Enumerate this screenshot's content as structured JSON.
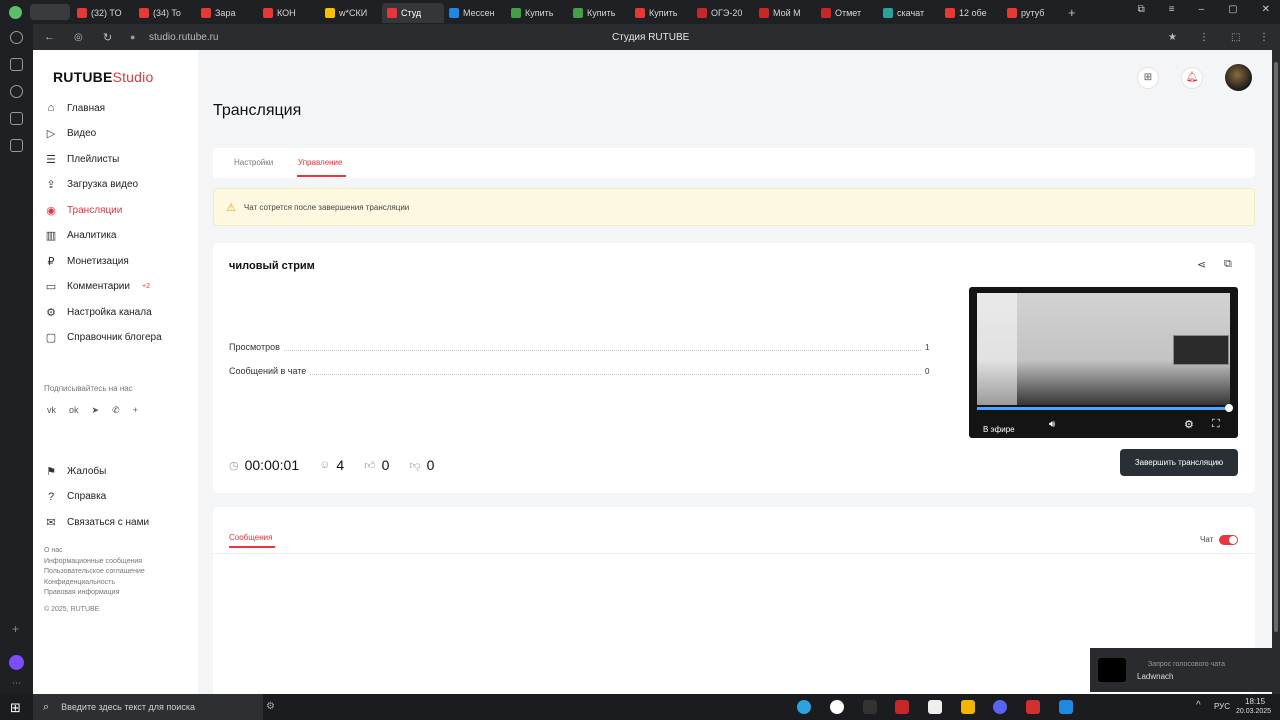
{
  "browser": {
    "tabs": [
      {
        "label": "(32) TO",
        "color": "#e53935",
        "active": false
      },
      {
        "label": "(34) To",
        "color": "#e53935",
        "active": false
      },
      {
        "label": "Зара",
        "color": "#e53935",
        "active": false
      },
      {
        "label": "КОН",
        "color": "#e53935",
        "active": false
      },
      {
        "label": "w*СКИ",
        "color": "#f6c000",
        "active": false
      },
      {
        "label": "Студ",
        "color": "#e8353f",
        "active": true
      },
      {
        "label": "Мессен",
        "color": "#1e88e5",
        "active": false
      },
      {
        "label": "Купить",
        "color": "#43a047",
        "active": false
      },
      {
        "label": "Купить",
        "color": "#43a047",
        "active": false
      },
      {
        "label": "Купить",
        "color": "#e53935",
        "active": false
      },
      {
        "label": "ОГЭ-20",
        "color": "#c62828",
        "active": false
      },
      {
        "label": "Мой М",
        "color": "#c62828",
        "active": false
      },
      {
        "label": "Отмет",
        "color": "#c62828",
        "active": false
      },
      {
        "label": "скачат",
        "color": "#26a69a",
        "active": false
      },
      {
        "label": "12 обе",
        "color": "#e53935",
        "active": false
      },
      {
        "label": "рутуб",
        "color": "#e53935",
        "active": false
      }
    ],
    "url": "studio.rutube.ru",
    "page_title": "Студия RUTUBE"
  },
  "sidebar": {
    "logo_main": "RUTUBE",
    "logo_sub": "Studio",
    "items": [
      {
        "label": "Главная",
        "icon": "home-icon",
        "glyph": "⌂"
      },
      {
        "label": "Видео",
        "icon": "video-icon",
        "glyph": "▷"
      },
      {
        "label": "Плейлисты",
        "icon": "playlist-icon",
        "glyph": "☰"
      },
      {
        "label": "Загрузка видео",
        "icon": "upload-icon",
        "glyph": "⇪"
      },
      {
        "label": "Трансляции",
        "icon": "broadcast-icon",
        "glyph": "◉",
        "active": true
      },
      {
        "label": "Аналитика",
        "icon": "analytics-icon",
        "glyph": "▥"
      },
      {
        "label": "Монетизация",
        "icon": "monetization-icon",
        "glyph": "₽"
      },
      {
        "label": "Комментарии",
        "icon": "comments-icon",
        "glyph": "▭",
        "badge": "+2"
      },
      {
        "label": "Настройка канала",
        "icon": "settings-icon",
        "glyph": "⚙"
      },
      {
        "label": "Справочник блогера",
        "icon": "guide-icon",
        "glyph": "▢"
      }
    ],
    "follow_label": "Подписывайтесь на нас",
    "socials": [
      "vk",
      "ok",
      "tg",
      "viber",
      "+"
    ],
    "bottom_items": [
      {
        "label": "Жалобы",
        "icon": "flag-icon",
        "glyph": "⚑"
      },
      {
        "label": "Справка",
        "icon": "help-icon",
        "glyph": "?"
      },
      {
        "label": "Связаться с нами",
        "icon": "mail-icon",
        "glyph": "✉"
      }
    ],
    "footer_links": [
      "О нас",
      "Информационные сообщения",
      "Пользовательское соглашение",
      "Конфиденциальность",
      "Правовая информация",
      "© 2025, RUTUBE"
    ]
  },
  "main": {
    "title": "Трансляция",
    "tabs": [
      {
        "label": "Настройки",
        "active": false
      },
      {
        "label": "Управление",
        "active": true
      }
    ],
    "warning": "Чат сотрется после завершения трансляции",
    "stream": {
      "name": "чиловый стрим",
      "stats": [
        {
          "label": "Просмотров",
          "value": "1"
        },
        {
          "label": "Сообщений в чате",
          "value": "0"
        }
      ],
      "duration": "00:00:01",
      "viewers": "4",
      "likes": "0",
      "dislikes": "0",
      "end_button": "Завершить трансляцию",
      "preview_live_label": "В эфире"
    },
    "chat": {
      "tab": "Сообщения",
      "toggle_label": "Чат",
      "toggle_on": true
    }
  },
  "taskbar": {
    "search_placeholder": "Введите здесь текст для поиска",
    "lang": "РУС",
    "time": "18:15",
    "date": "20.03.2025"
  },
  "notification": {
    "title": "Запрос голосового чата",
    "user": "Ladwnach"
  }
}
